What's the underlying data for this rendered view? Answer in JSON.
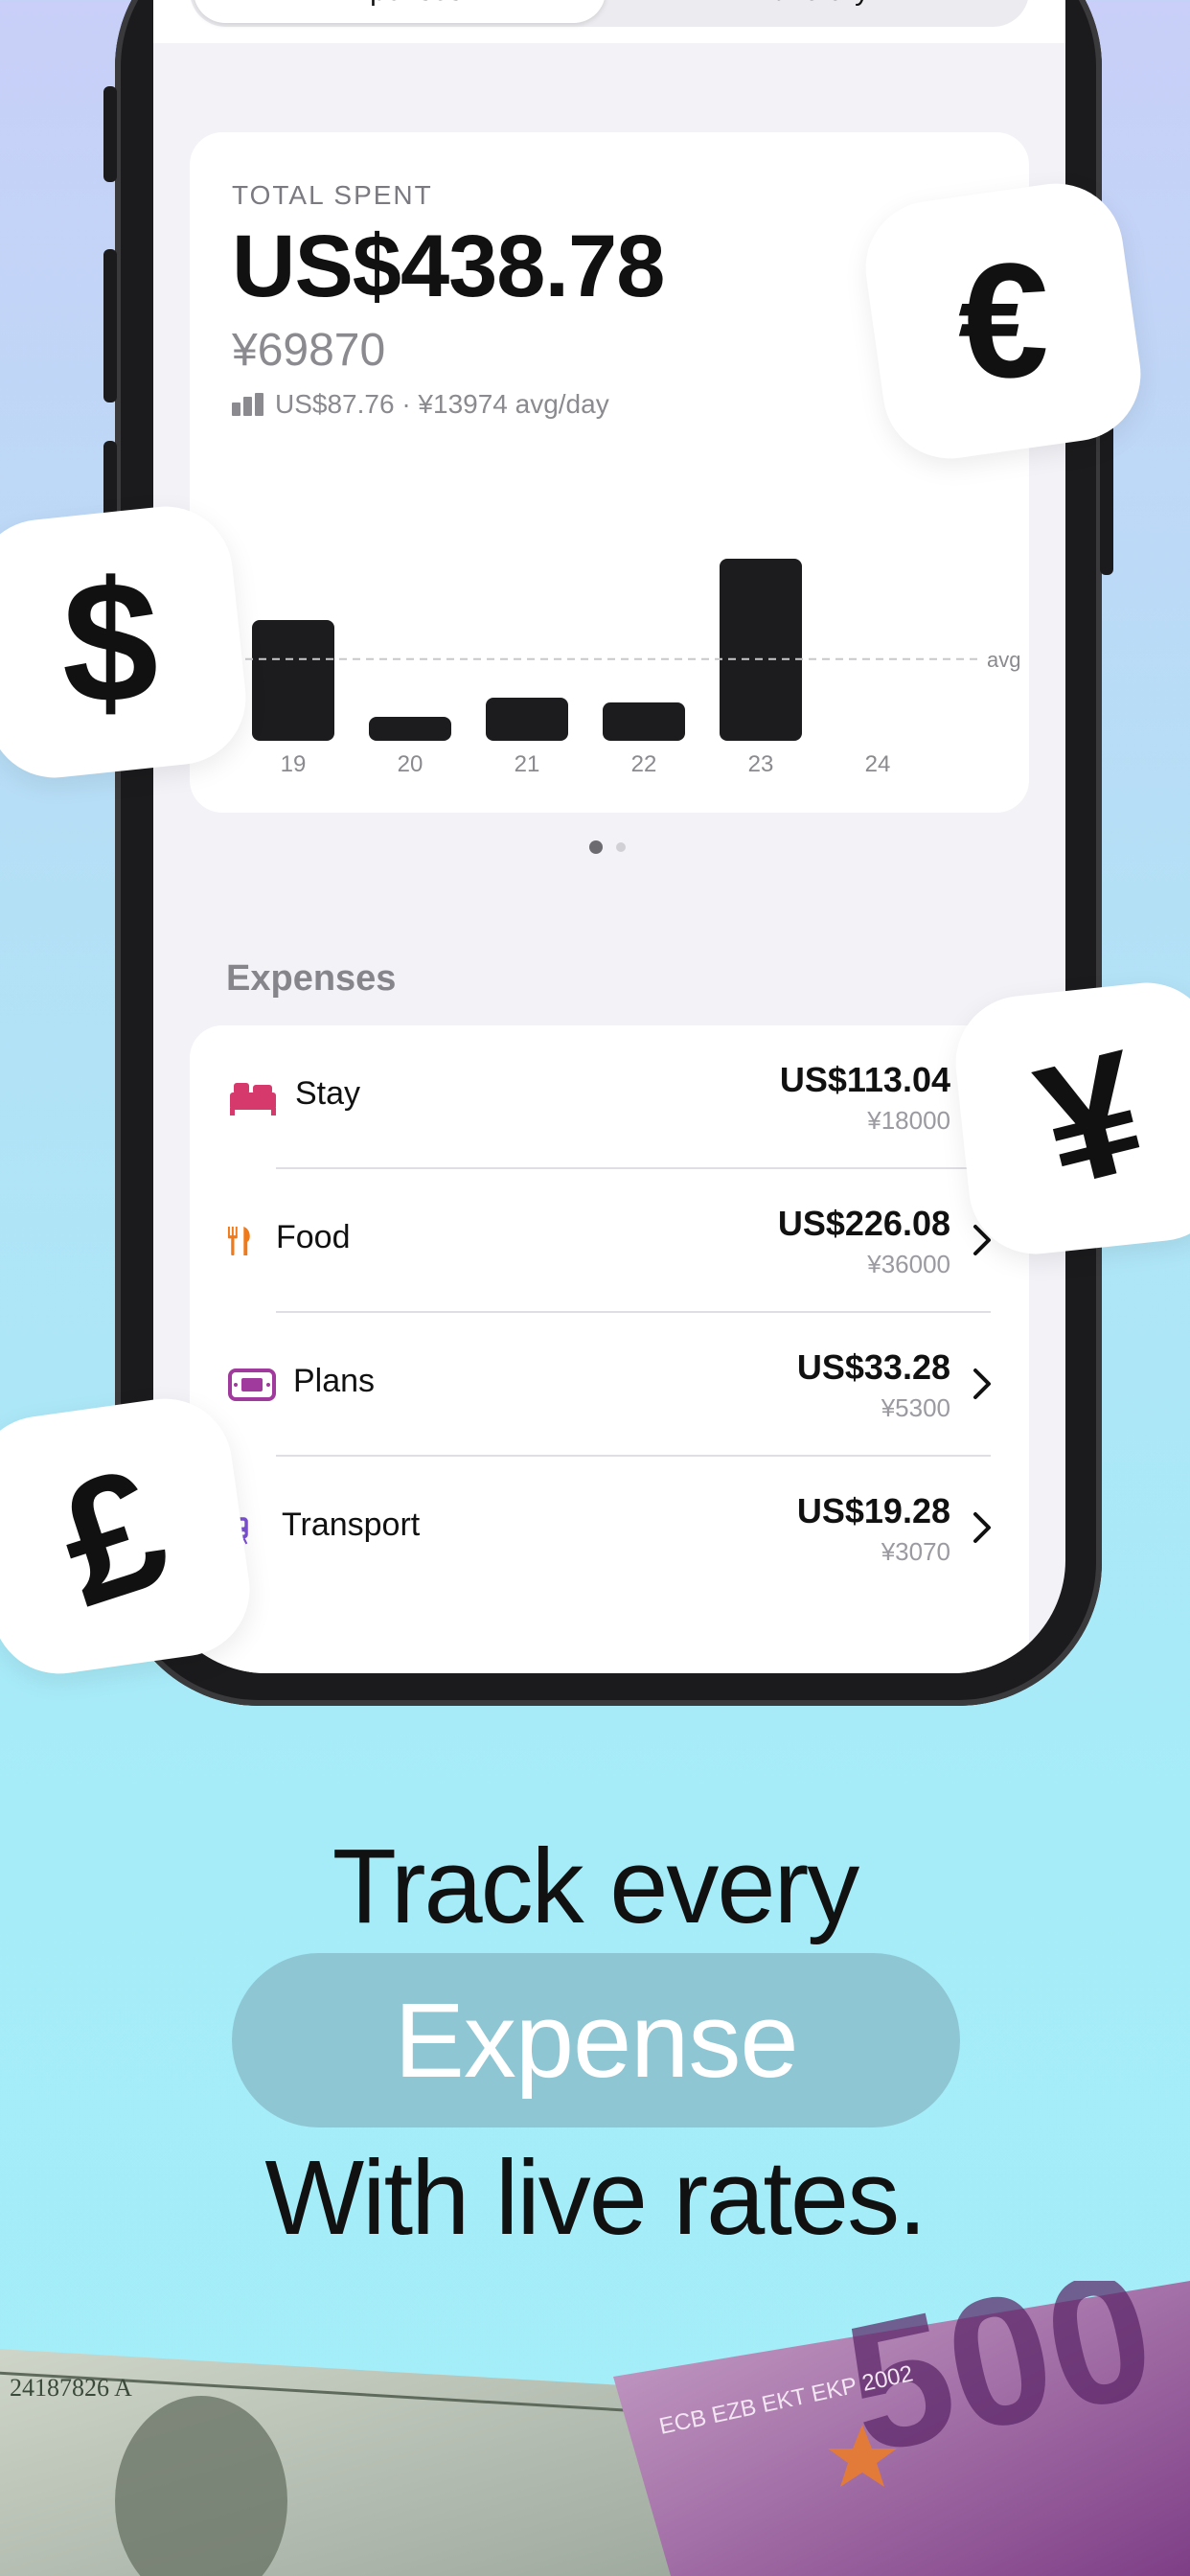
{
  "tabs": {
    "expenses": "Expenses",
    "itinerary": "Itinerary"
  },
  "summary": {
    "label": "TOTAL SPENT",
    "total_usd": "US$438.78",
    "total_yen": "¥69870",
    "avg": "US$87.76 · ¥13974 avg/day"
  },
  "chart_data": {
    "type": "bar",
    "categories": [
      "19",
      "20",
      "21",
      "22",
      "23",
      "24"
    ],
    "values": [
      126,
      25,
      45,
      40,
      190,
      0
    ],
    "reference_line": {
      "label": "avg"
    },
    "grid": false,
    "axes_labels": false
  },
  "pager": {
    "count": 2,
    "active": 0
  },
  "expenses": {
    "title": "Expenses",
    "items": [
      {
        "name": "Stay",
        "amount": "US$113.04",
        "sub": "¥18000",
        "icon": "bed-icon",
        "color": "#d63a6c"
      },
      {
        "name": "Food",
        "amount": "US$226.08",
        "sub": "¥36000",
        "icon": "fork-knife-icon",
        "color": "#f07a1a"
      },
      {
        "name": "Plans",
        "amount": "US$33.28",
        "sub": "¥5300",
        "icon": "ticket-icon",
        "color": "#a03a9c"
      },
      {
        "name": "Transport",
        "amount": "US$19.28",
        "sub": "¥3070",
        "icon": "tram-icon",
        "color": "#7b4fd0"
      }
    ]
  },
  "badges": [
    "€",
    "$",
    "¥",
    "£"
  ],
  "headline": {
    "line1": "Track every",
    "highlight": "Expense",
    "line3": "With live rates."
  },
  "colors": {
    "accent_pill": "#8ec6d3",
    "bar": "#1c1c1e"
  }
}
